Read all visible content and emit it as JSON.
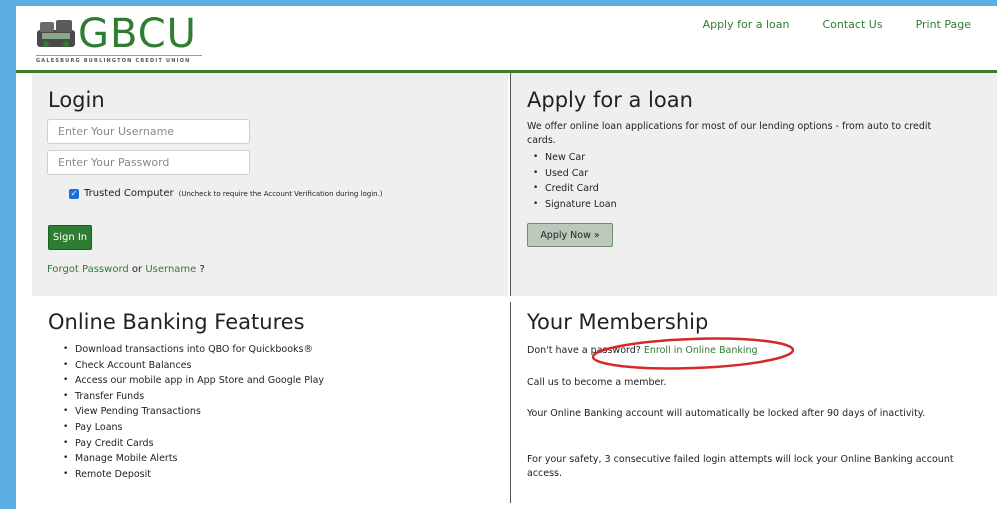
{
  "brand": {
    "name": "GBCU",
    "tagline": "GALESBURG BURLINGTON CREDIT UNION",
    "color": "#2e7d32"
  },
  "topnav": {
    "apply": "Apply for a loan",
    "contact": "Contact Us",
    "print": "Print Page"
  },
  "login": {
    "title": "Login",
    "username_placeholder": "Enter Your Username",
    "password_placeholder": "Enter Your Password",
    "trusted_label": "Trusted Computer",
    "trusted_note": "(Uncheck to require the Account Verification during login.)",
    "trusted_checked": true,
    "signin_label": "Sign In",
    "forgot_password": "Forgot Password",
    "or": "or",
    "username_link": "Username",
    "question": "?"
  },
  "loan": {
    "title": "Apply for a loan",
    "description": "We offer online loan applications for most of our lending options - from auto to credit cards.",
    "items": [
      "New Car",
      "Used Car",
      "Credit Card",
      "Signature Loan"
    ],
    "apply_label": "Apply Now »"
  },
  "features": {
    "title": "Online Banking Features",
    "items": [
      "Download transactions into QBO for Quickbooks®",
      "Check Account Balances",
      "Access our mobile app in App Store and Google Play",
      "Transfer Funds",
      "View Pending Transactions",
      "Pay Loans",
      "Pay Credit Cards",
      "Manage Mobile Alerts",
      "Remote Deposit"
    ]
  },
  "membership": {
    "title": "Your Membership",
    "no_password": "Don't have a password?",
    "enroll_link": "Enroll in Online Banking",
    "call": "Call us to become a member.",
    "lock_notice": "Your Online Banking account will automatically be locked after 90 days of inactivity.",
    "safety_notice": "For your safety, 3 consecutive failed login attempts will lock your Online Banking account access."
  },
  "annotation_color": "#d62828"
}
